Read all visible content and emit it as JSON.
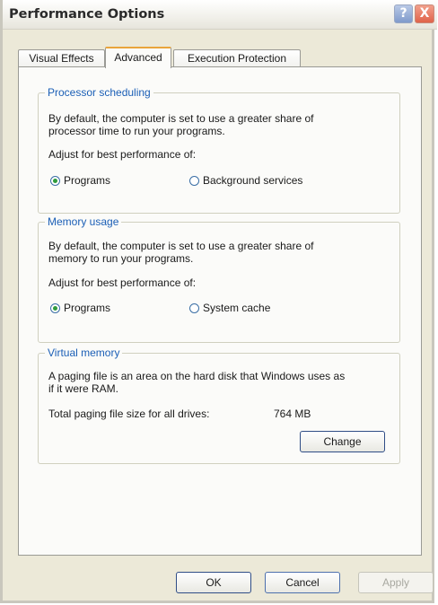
{
  "window": {
    "title": "Performance Options",
    "help_glyph": "?",
    "close_glyph": "X"
  },
  "tabs": [
    {
      "label": "Visual Effects",
      "selected": false
    },
    {
      "label": "Advanced",
      "selected": true
    },
    {
      "label": "Execution Protection",
      "selected": false
    }
  ],
  "processor": {
    "legend": "Processor scheduling",
    "desc_line1": "By default, the computer is set to use a greater share of",
    "desc_line2": "processor time to run your programs.",
    "adjust": "Adjust for best performance of:",
    "options": [
      {
        "label": "Programs",
        "selected": true
      },
      {
        "label": "Background services",
        "selected": false
      }
    ]
  },
  "memory": {
    "legend": "Memory usage",
    "desc_line1": "By default, the computer is set to use a greater share of",
    "desc_line2": "memory to run your programs.",
    "adjust": "Adjust for best performance of:",
    "options": [
      {
        "label": "Programs",
        "selected": true
      },
      {
        "label": "System cache",
        "selected": false
      }
    ]
  },
  "virtual": {
    "legend": "Virtual memory",
    "desc_line1": "A paging file is an area on the hard disk that Windows uses as",
    "desc_line2": "if it were RAM.",
    "total_label": "Total paging file size for all drives:",
    "total_value": "764 MB",
    "change_label": "Change"
  },
  "footer": {
    "ok_label": "OK",
    "cancel_label": "Cancel",
    "apply_label": "Apply"
  },
  "colors": {
    "legend": "#1b5fb6",
    "window_bg": "#ece9d8",
    "tab_accent": "#e9a53c",
    "radio_selected": "#2f9b3c"
  }
}
